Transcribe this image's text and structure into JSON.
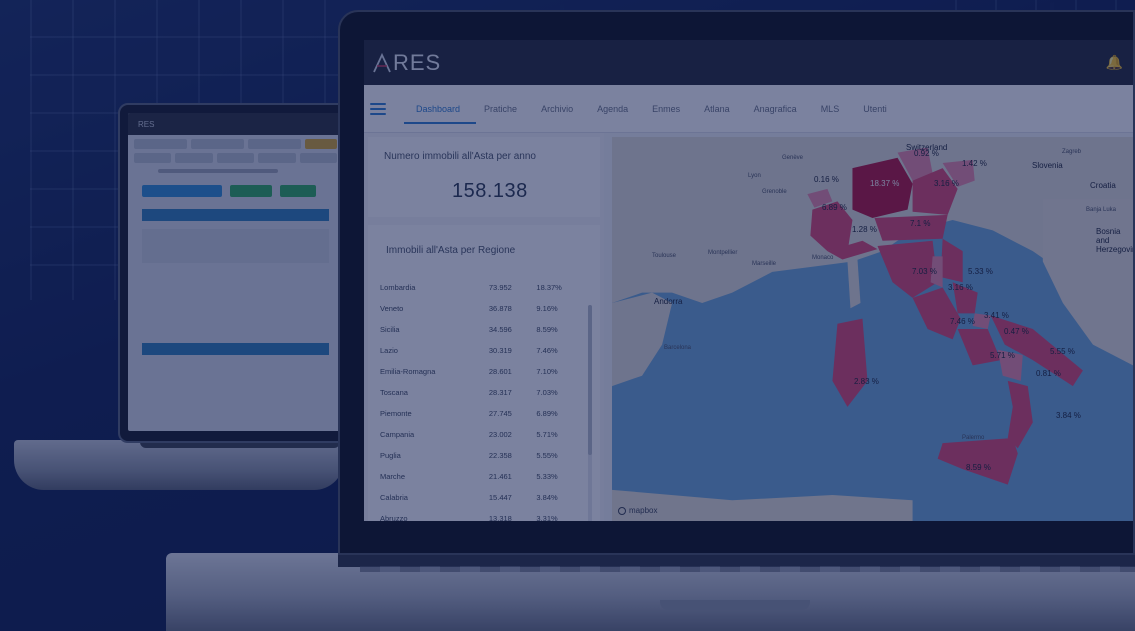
{
  "app": {
    "logo_text": "RES",
    "logo_prefix": "A"
  },
  "nav": {
    "tabs": [
      {
        "label": "Dashboard"
      },
      {
        "label": "Pratiche"
      },
      {
        "label": "Archivio"
      },
      {
        "label": "Agenda"
      },
      {
        "label": "Enmes"
      },
      {
        "label": "Atlana"
      },
      {
        "label": "Anagrafica"
      },
      {
        "label": "MLS"
      },
      {
        "label": "Utenti"
      }
    ]
  },
  "stats": {
    "title": "Numero immobili all'Asta per anno",
    "value": "158.138"
  },
  "regions": {
    "title": "Immobili all'Asta per Regione",
    "rows": [
      {
        "name": "Lombardia",
        "count": "73.952",
        "pct": "18.37%"
      },
      {
        "name": "Veneto",
        "count": "36.878",
        "pct": "9.16%"
      },
      {
        "name": "Sicilia",
        "count": "34.596",
        "pct": "8.59%"
      },
      {
        "name": "Lazio",
        "count": "30.319",
        "pct": "7.46%"
      },
      {
        "name": "Emilia-Romagna",
        "count": "28.601",
        "pct": "7.10%"
      },
      {
        "name": "Toscana",
        "count": "28.317",
        "pct": "7.03%"
      },
      {
        "name": "Piemonte",
        "count": "27.745",
        "pct": "6.89%"
      },
      {
        "name": "Campania",
        "count": "23.002",
        "pct": "5.71%"
      },
      {
        "name": "Puglia",
        "count": "22.358",
        "pct": "5.55%"
      },
      {
        "name": "Marche",
        "count": "21.461",
        "pct": "5.33%"
      },
      {
        "name": "Calabria",
        "count": "15.447",
        "pct": "3.84%"
      },
      {
        "name": "Abruzzo",
        "count": "13.318",
        "pct": "3.31%"
      }
    ]
  },
  "map": {
    "labels": [
      {
        "text": "18.37 %"
      },
      {
        "text": "0.92 %"
      },
      {
        "text": "1.42 %"
      },
      {
        "text": "3.16 %"
      },
      {
        "text": "0.16 %"
      },
      {
        "text": "6.89 %"
      },
      {
        "text": "1.28 %"
      },
      {
        "text": "7.1 %"
      },
      {
        "text": "7.03 %"
      },
      {
        "text": "5.33 %"
      },
      {
        "text": "3.16 %"
      },
      {
        "text": "3.41 %"
      },
      {
        "text": "7.46 %"
      },
      {
        "text": "0.47 %"
      },
      {
        "text": "5.71 %"
      },
      {
        "text": "5.55 %"
      },
      {
        "text": "0.81 %"
      },
      {
        "text": "2.83 %"
      },
      {
        "text": "3.84 %"
      },
      {
        "text": "8.59 %"
      }
    ],
    "places": {
      "switzerland": "Switzerland",
      "slovenia": "Slovenia",
      "croatia": "Croatia",
      "bosnia": "Bosnia and Herzegovina",
      "andorra": "Andorra",
      "monaco": "Monaco",
      "barcelona": "Barcelona",
      "toulouse": "Toulouse",
      "montpellier": "Montpellier",
      "marseille": "Marseille",
      "geneve": "Genève",
      "grenoble": "Grenoble",
      "lyon": "Lyon",
      "zagreb": "Zagreb",
      "banja_luka": "Banja Luka",
      "palermo": "Palermo"
    },
    "attribution": "mapbox"
  },
  "colors": {
    "accent": "#2f7fd0",
    "region_high": "#b5133a",
    "region_mid": "#de4870",
    "region_low": "#ea8aa6",
    "sea": "#6fa8d6",
    "land": "#e3e0d8"
  }
}
